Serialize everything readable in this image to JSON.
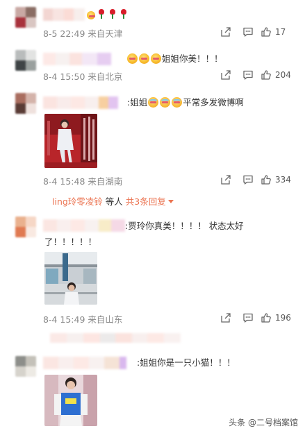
{
  "comments": [
    {
      "text": "🌹🌹🌹",
      "meta": "8-5 22:49 来自天津",
      "likes": "17"
    },
    {
      "text": "姐姐你美！！！",
      "meta": "8-4 15:50 来自北京",
      "likes": "204"
    },
    {
      "text": ":姐姐",
      "text2": "平常多发微博啊",
      "meta": "8-4 15:48 来自湖南",
      "likes": "334",
      "reply": {
        "user": "ling玲零凌铃",
        "middle": " 等人 ",
        "count": "共3条回复"
      }
    },
    {
      "text": ":贾玲你真美！！！！ 状态太好了！！！！！",
      "meta": "8-4 15:49 来自山东",
      "likes": "196"
    },
    {
      "text": ":姐姐你是一只小猫！！！"
    }
  ],
  "icons": {
    "share": "share-icon",
    "comment": "comment-icon",
    "like": "thumbs-up-icon"
  },
  "watermark": "头条 @二号档案馆",
  "colors": {
    "meta_text": "#888888",
    "reply_link": "#eb7350",
    "body_text": "#333333"
  }
}
